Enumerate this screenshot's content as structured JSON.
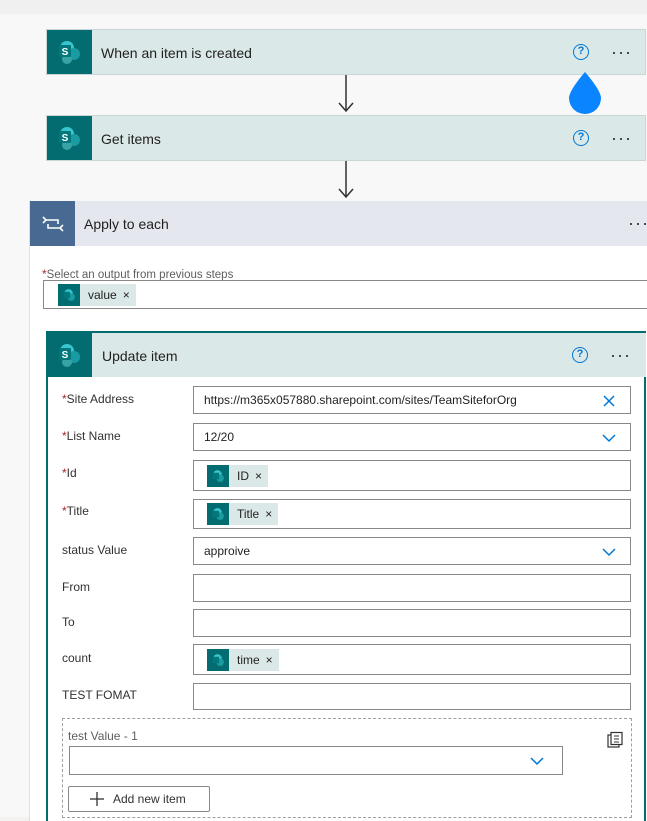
{
  "trigger": {
    "title": "When an item is created",
    "help": "?"
  },
  "get_items": {
    "title": "Get items",
    "help": "?"
  },
  "apply_each": {
    "title": "Apply to each",
    "output_label": "Select an output from previous steps",
    "output_token": "value"
  },
  "update_item": {
    "title": "Update item",
    "help": "?",
    "fields": {
      "site_address": {
        "label": "Site Address",
        "value": "https://m365x057880.sharepoint.com/sites/TeamSiteforOrg"
      },
      "list_name": {
        "label": "List Name",
        "value": "12/20"
      },
      "id": {
        "label": "Id",
        "token": "ID"
      },
      "title": {
        "label": "Title",
        "token": "Title"
      },
      "status_value": {
        "label": "status Value",
        "value": "approive"
      },
      "from": {
        "label": "From",
        "value": ""
      },
      "to": {
        "label": "To",
        "value": ""
      },
      "count": {
        "label": "count",
        "token": "time"
      },
      "test_fomat": {
        "label": "TEST FOMAT",
        "value": ""
      }
    },
    "array": {
      "label": "test Value - 1",
      "add_label": "Add new item"
    }
  },
  "required_mark": "*",
  "remove_glyph": "×",
  "more_glyph": "···",
  "colors": {
    "sharepoint": "#036c70",
    "accent": "#0078d4",
    "loop": "#486991"
  }
}
